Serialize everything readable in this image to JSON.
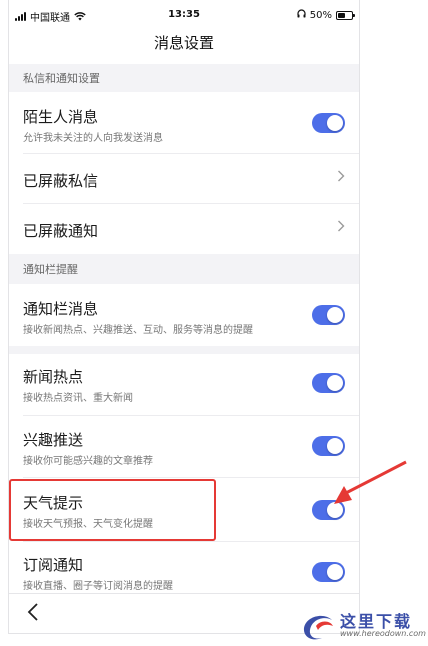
{
  "status_bar": {
    "carrier": "中国联通",
    "time": "13:35",
    "battery_text": "50%",
    "battery_level": 0.5
  },
  "nav": {
    "title": "消息设置",
    "back_icon": "chevron-left-icon"
  },
  "sections": [
    {
      "header": "私信和通知设置"
    },
    {
      "header": "通知栏提醒"
    }
  ],
  "rows": {
    "stranger": {
      "title": "陌生人消息",
      "subtitle": "允许我未关注的人向我发送消息",
      "enabled": true
    },
    "blocked_dm": {
      "title": "已屏蔽私信"
    },
    "blocked_notice": {
      "title": "已屏蔽通知"
    },
    "notif_bar": {
      "title": "通知栏消息",
      "subtitle": "接收新闻热点、兴趣推送、互动、服务等消息的提醒",
      "enabled": true
    },
    "news_hot": {
      "title": "新闻热点",
      "subtitle": "接收热点资讯、重大新闻",
      "enabled": true
    },
    "interest": {
      "title": "兴趣推送",
      "subtitle": "接收你可能感兴趣的文章推荐",
      "enabled": true
    },
    "weather": {
      "title": "天气提示",
      "subtitle": "接收天气预报、天气变化提醒",
      "enabled": true
    },
    "subscribe": {
      "title": "订阅通知",
      "subtitle": "接收直播、圈子等订阅消息的提醒",
      "enabled": true
    }
  },
  "watermark": {
    "brand": "这里下载",
    "url": "www.hereodown.com"
  },
  "colors": {
    "accent": "#4d6ee8",
    "highlight": "#e53935",
    "section_bg": "#f3f3f6"
  }
}
